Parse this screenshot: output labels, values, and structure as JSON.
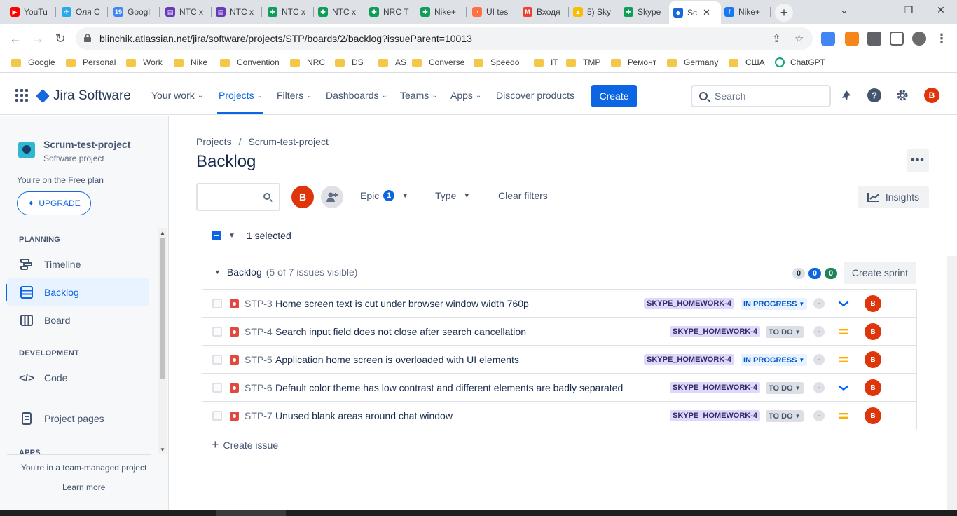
{
  "browser": {
    "tabs": [
      {
        "label": "YouTu",
        "color": "#ff0000",
        "glyph": "▶"
      },
      {
        "label": "Оля С",
        "color": "#29a9eb",
        "glyph": "✈"
      },
      {
        "label": "Googl",
        "color": "#4285f4",
        "glyph": "19"
      },
      {
        "label": "NTC x",
        "color": "#673ab7",
        "glyph": "▤"
      },
      {
        "label": "NTC x",
        "color": "#673ab7",
        "glyph": "▤"
      },
      {
        "label": "NTC x",
        "color": "#0f9d58",
        "glyph": "✚"
      },
      {
        "label": "NTC x",
        "color": "#0f9d58",
        "glyph": "✚"
      },
      {
        "label": "NRC T",
        "color": "#0f9d58",
        "glyph": "✚"
      },
      {
        "label": "Nike+",
        "color": "#0f9d58",
        "glyph": "✚"
      },
      {
        "label": "UI tes",
        "color": "#ff7043",
        "glyph": "◔"
      },
      {
        "label": "Входя",
        "color": "#ea4335",
        "glyph": "M"
      },
      {
        "label": "5) Sky",
        "color": "#fbbc04",
        "glyph": "▲"
      },
      {
        "label": "Skype",
        "color": "#0f9d58",
        "glyph": "✚"
      },
      {
        "label": "Sc",
        "color": "#1868db",
        "glyph": "◆"
      },
      {
        "label": "Nike+",
        "color": "#1877f2",
        "glyph": "f"
      }
    ],
    "url": "blinchik.atlassian.net/jira/software/projects/STP/boards/2/backlog?issueParent=10013",
    "bookmarks": [
      "Google",
      "Personal",
      "Work",
      "Nike",
      "Convention",
      "NRC",
      "DS",
      "AS",
      "Converse",
      "Speedo",
      "IT",
      "TMP",
      "Ремонт",
      "Germany",
      "США",
      "ChatGPT"
    ]
  },
  "jira_nav": {
    "product": "Jira Software",
    "your_work": "Your work",
    "projects": "Projects",
    "filters": "Filters",
    "dashboards": "Dashboards",
    "teams": "Teams",
    "apps": "Apps",
    "discover": "Discover products",
    "create": "Create",
    "search_placeholder": "Search",
    "avatar_initial": "B"
  },
  "sidebar": {
    "project_name": "Scrum-test-project",
    "project_type": "Software project",
    "plan": "You're on the Free plan",
    "upgrade": "UPGRADE",
    "planning_header": "PLANNING",
    "timeline": "Timeline",
    "backlog": "Backlog",
    "board": "Board",
    "development_header": "DEVELOPMENT",
    "code": "Code",
    "project_pages": "Project pages",
    "apps_header": "APPS",
    "team_managed": "You're in a team-managed project",
    "learn_more": "Learn more"
  },
  "main": {
    "breadcrumb": [
      "Projects",
      "Scrum-test-project"
    ],
    "title": "Backlog",
    "more": "•••",
    "filter_avatar": "B",
    "epic_filter": "Epic",
    "epic_count": "1",
    "type_filter": "Type",
    "clear_filters": "Clear filters",
    "insights": "Insights",
    "selected": "1 selected",
    "backlog_name": "Backlog",
    "backlog_count": "(5 of 7 issues visible)",
    "pills": {
      "todo": "0",
      "inprogress": "0",
      "done": "0"
    },
    "create_sprint": "Create sprint",
    "create_issue": "Create issue",
    "issues": [
      {
        "key": "STP-3",
        "summary": "Home screen text is cut under browser window width 760p",
        "epic": "SKYPE_HOMEWORK-4",
        "status": "IN PROGRESS",
        "estimate": "-",
        "priority": "low",
        "assignee": "B"
      },
      {
        "key": "STP-4",
        "summary": "Search input field does not close after search cancellation",
        "epic": "SKYPE_HOMEWORK-4",
        "status": "TO DO",
        "estimate": "-",
        "priority": "medium",
        "assignee": "B"
      },
      {
        "key": "STP-5",
        "summary": "Application home screen is overloaded with UI elements",
        "epic": "SKYPE_HOMEWORK-4",
        "status": "IN PROGRESS",
        "estimate": "-",
        "priority": "medium",
        "assignee": "B"
      },
      {
        "key": "STP-6",
        "summary": "Default color theme has low contrast and different elements are badly separated",
        "epic": "SKYPE_HOMEWORK-4",
        "status": "TO DO",
        "estimate": "-",
        "priority": "low",
        "assignee": "B"
      },
      {
        "key": "STP-7",
        "summary": "Unused blank areas around chat window",
        "epic": "SKYPE_HOMEWORK-4",
        "status": "TO DO",
        "estimate": "-",
        "priority": "medium",
        "assignee": "B"
      }
    ]
  },
  "colors": {
    "accent": "#0c66e4",
    "avatar": "#de350b",
    "bug": "#e2483d",
    "epic_bg": "#dfd8fd",
    "priority_medium": "#ffab00",
    "priority_low": "#0065ff"
  }
}
